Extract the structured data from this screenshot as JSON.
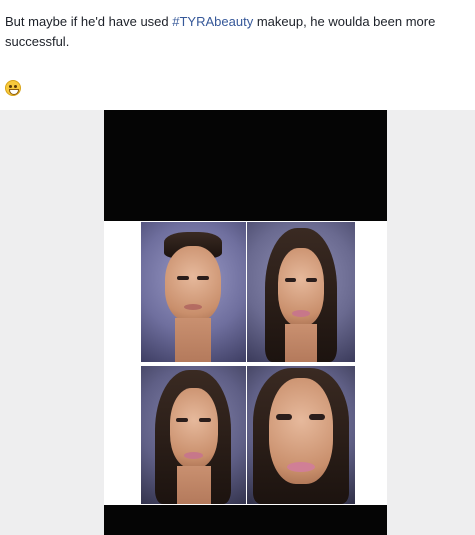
{
  "post": {
    "text_before": "But maybe if he'd have used ",
    "hashtag": "#TYRAbeauty",
    "text_after": " makeup, he woulda been more successful."
  },
  "emoji": {
    "icon": "grinning-face-with-tongue-emoji"
  },
  "photo": {
    "background": "#eeeeef",
    "bars": "#050505"
  }
}
